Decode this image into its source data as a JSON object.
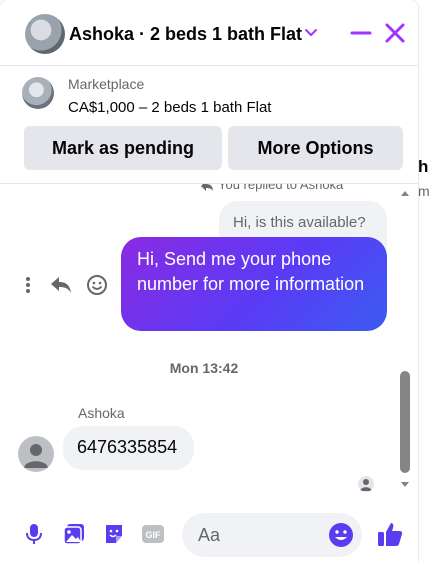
{
  "header": {
    "title": "Ashoka · 2 beds 1 bath Flat"
  },
  "marketplace": {
    "label": "Marketplace",
    "listing": "CA$1,000 – 2 beds 1 bath Flat",
    "buttons": {
      "pending": "Mark as pending",
      "more": "More Options"
    }
  },
  "messages": {
    "replied_note": "You replied to Ashoka",
    "quoted_text": "Hi, is this available?",
    "sent_text": "Hi, Send me your phone number for more information",
    "timestamp": "Mon 13:42",
    "sender_name": "Ashoka",
    "received_text": "6476335854"
  },
  "composer": {
    "placeholder": "Aa"
  },
  "background": {
    "heading_fragment": "h",
    "subtext_fragment": "m."
  },
  "colors": {
    "accent": "#a033ff",
    "like_blue": "#0084ff",
    "sent_gradient_start": "#8a2be2",
    "sent_gradient_end": "#3b5cf2"
  }
}
